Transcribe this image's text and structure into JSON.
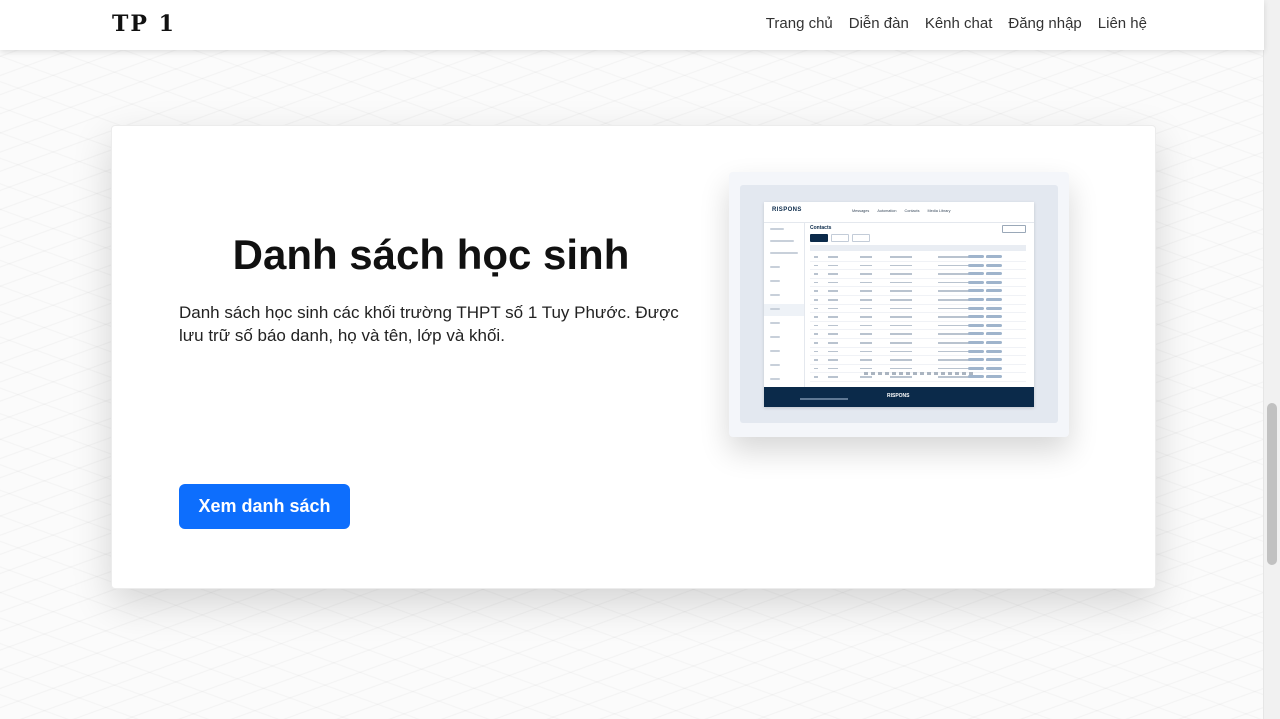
{
  "navbar": {
    "brand": "TP 1",
    "links": [
      "Trang chủ",
      "Diễn đàn",
      "Kênh chat",
      "Đăng nhập",
      "Liên hệ"
    ]
  },
  "card": {
    "title": "Danh sách học sinh",
    "description": "Danh sách học sinh các khối trường THPT số 1 Tuy Phước. Được lưu trữ số báo danh, họ và tên, lớp và khối.",
    "button_label": "Xem danh sách"
  },
  "preview": {
    "logo": "RISPONS",
    "heading": "Contacts",
    "menu": [
      "Messages",
      "Automation",
      "Contacts",
      "Media Library"
    ],
    "footer_logo": "RISPONS"
  },
  "colors": {
    "primary": "#0d6efd",
    "preview_dark": "#0b2a4a"
  }
}
